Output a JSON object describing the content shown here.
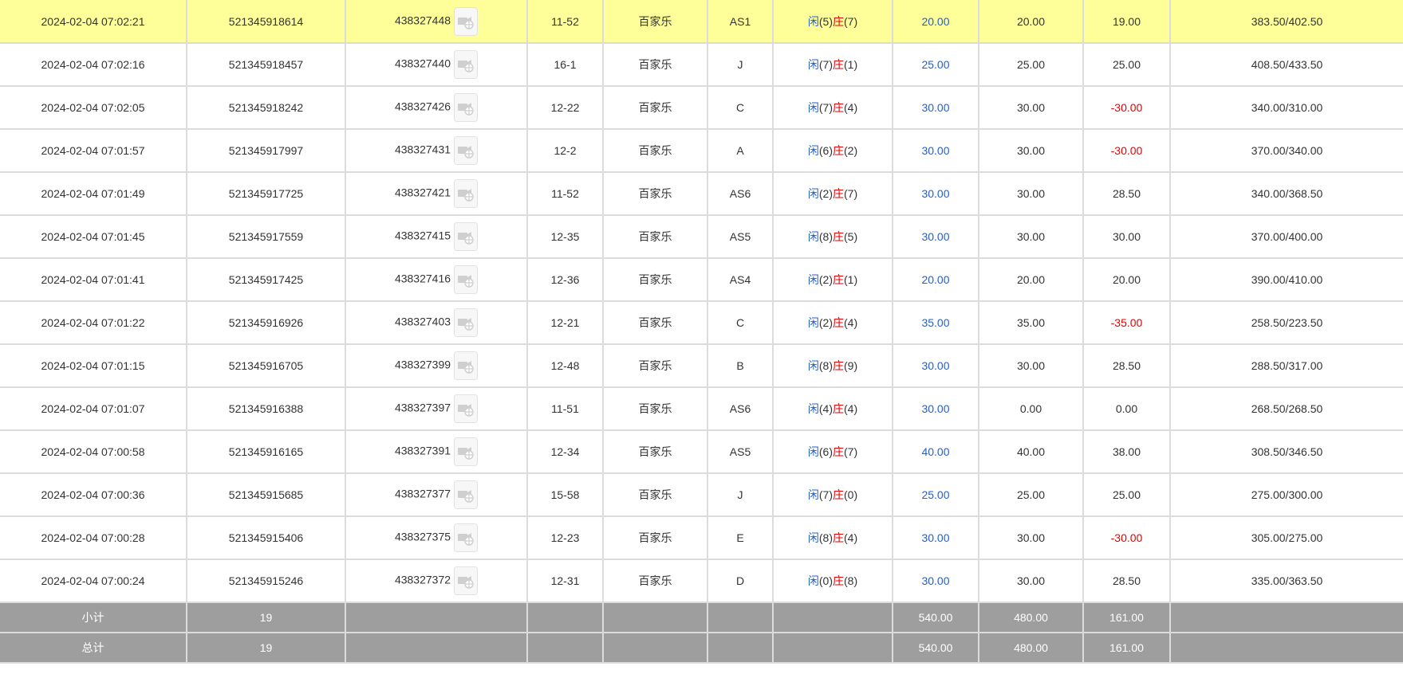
{
  "rows": [
    {
      "time": "2024-02-04 07:02:21",
      "order_no": "521345918614",
      "round_no": "438327448",
      "shoe": "11-52",
      "game": "百家乐",
      "table": "AS1",
      "player_label": "闲",
      "player_score": "(5)",
      "banker_label": "庄",
      "banker_score": "(7)",
      "bet": "20.00",
      "valid_bet": "20.00",
      "win_loss": "19.00",
      "win_loss_negative": false,
      "balance": "383.50/402.50",
      "highlight": true
    },
    {
      "time": "2024-02-04 07:02:16",
      "order_no": "521345918457",
      "round_no": "438327440",
      "shoe": "16-1",
      "game": "百家乐",
      "table": "J",
      "player_label": "闲",
      "player_score": "(7)",
      "banker_label": "庄",
      "banker_score": "(1)",
      "bet": "25.00",
      "valid_bet": "25.00",
      "win_loss": "25.00",
      "win_loss_negative": false,
      "balance": "408.50/433.50",
      "highlight": false
    },
    {
      "time": "2024-02-04 07:02:05",
      "order_no": "521345918242",
      "round_no": "438327426",
      "shoe": "12-22",
      "game": "百家乐",
      "table": "C",
      "player_label": "闲",
      "player_score": "(7)",
      "banker_label": "庄",
      "banker_score": "(4)",
      "bet": "30.00",
      "valid_bet": "30.00",
      "win_loss": "-30.00",
      "win_loss_negative": true,
      "balance": "340.00/310.00",
      "highlight": false
    },
    {
      "time": "2024-02-04 07:01:57",
      "order_no": "521345917997",
      "round_no": "438327431",
      "shoe": "12-2",
      "game": "百家乐",
      "table": "A",
      "player_label": "闲",
      "player_score": "(6)",
      "banker_label": "庄",
      "banker_score": "(2)",
      "bet": "30.00",
      "valid_bet": "30.00",
      "win_loss": "-30.00",
      "win_loss_negative": true,
      "balance": "370.00/340.00",
      "highlight": false
    },
    {
      "time": "2024-02-04 07:01:49",
      "order_no": "521345917725",
      "round_no": "438327421",
      "shoe": "11-52",
      "game": "百家乐",
      "table": "AS6",
      "player_label": "闲",
      "player_score": "(2)",
      "banker_label": "庄",
      "banker_score": "(7)",
      "bet": "30.00",
      "valid_bet": "30.00",
      "win_loss": "28.50",
      "win_loss_negative": false,
      "balance": "340.00/368.50",
      "highlight": false
    },
    {
      "time": "2024-02-04 07:01:45",
      "order_no": "521345917559",
      "round_no": "438327415",
      "shoe": "12-35",
      "game": "百家乐",
      "table": "AS5",
      "player_label": "闲",
      "player_score": "(8)",
      "banker_label": "庄",
      "banker_score": "(5)",
      "bet": "30.00",
      "valid_bet": "30.00",
      "win_loss": "30.00",
      "win_loss_negative": false,
      "balance": "370.00/400.00",
      "highlight": false
    },
    {
      "time": "2024-02-04 07:01:41",
      "order_no": "521345917425",
      "round_no": "438327416",
      "shoe": "12-36",
      "game": "百家乐",
      "table": "AS4",
      "player_label": "闲",
      "player_score": "(2)",
      "banker_label": "庄",
      "banker_score": "(1)",
      "bet": "20.00",
      "valid_bet": "20.00",
      "win_loss": "20.00",
      "win_loss_negative": false,
      "balance": "390.00/410.00",
      "highlight": false
    },
    {
      "time": "2024-02-04 07:01:22",
      "order_no": "521345916926",
      "round_no": "438327403",
      "shoe": "12-21",
      "game": "百家乐",
      "table": "C",
      "player_label": "闲",
      "player_score": "(2)",
      "banker_label": "庄",
      "banker_score": "(4)",
      "bet": "35.00",
      "valid_bet": "35.00",
      "win_loss": "-35.00",
      "win_loss_negative": true,
      "balance": "258.50/223.50",
      "highlight": false
    },
    {
      "time": "2024-02-04 07:01:15",
      "order_no": "521345916705",
      "round_no": "438327399",
      "shoe": "12-48",
      "game": "百家乐",
      "table": "B",
      "player_label": "闲",
      "player_score": "(8)",
      "banker_label": "庄",
      "banker_score": "(9)",
      "bet": "30.00",
      "valid_bet": "30.00",
      "win_loss": "28.50",
      "win_loss_negative": false,
      "balance": "288.50/317.00",
      "highlight": false
    },
    {
      "time": "2024-02-04 07:01:07",
      "order_no": "521345916388",
      "round_no": "438327397",
      "shoe": "11-51",
      "game": "百家乐",
      "table": "AS6",
      "player_label": "闲",
      "player_score": "(4)",
      "banker_label": "庄",
      "banker_score": "(4)",
      "bet": "30.00",
      "valid_bet": "0.00",
      "win_loss": "0.00",
      "win_loss_negative": false,
      "balance": "268.50/268.50",
      "highlight": false
    },
    {
      "time": "2024-02-04 07:00:58",
      "order_no": "521345916165",
      "round_no": "438327391",
      "shoe": "12-34",
      "game": "百家乐",
      "table": "AS5",
      "player_label": "闲",
      "player_score": "(6)",
      "banker_label": "庄",
      "banker_score": "(7)",
      "bet": "40.00",
      "valid_bet": "40.00",
      "win_loss": "38.00",
      "win_loss_negative": false,
      "balance": "308.50/346.50",
      "highlight": false
    },
    {
      "time": "2024-02-04 07:00:36",
      "order_no": "521345915685",
      "round_no": "438327377",
      "shoe": "15-58",
      "game": "百家乐",
      "table": "J",
      "player_label": "闲",
      "player_score": "(7)",
      "banker_label": "庄",
      "banker_score": "(0)",
      "bet": "25.00",
      "valid_bet": "25.00",
      "win_loss": "25.00",
      "win_loss_negative": false,
      "balance": "275.00/300.00",
      "highlight": false
    },
    {
      "time": "2024-02-04 07:00:28",
      "order_no": "521345915406",
      "round_no": "438327375",
      "shoe": "12-23",
      "game": "百家乐",
      "table": "E",
      "player_label": "闲",
      "player_score": "(8)",
      "banker_label": "庄",
      "banker_score": "(4)",
      "bet": "30.00",
      "valid_bet": "30.00",
      "win_loss": "-30.00",
      "win_loss_negative": true,
      "balance": "305.00/275.00",
      "highlight": false
    },
    {
      "time": "2024-02-04 07:00:24",
      "order_no": "521345915246",
      "round_no": "438327372",
      "shoe": "12-31",
      "game": "百家乐",
      "table": "D",
      "player_label": "闲",
      "player_score": "(0)",
      "banker_label": "庄",
      "banker_score": "(8)",
      "bet": "30.00",
      "valid_bet": "30.00",
      "win_loss": "28.50",
      "win_loss_negative": false,
      "balance": "335.00/363.50",
      "highlight": false
    }
  ],
  "summary": [
    {
      "label": "小计",
      "count": "19",
      "bet": "540.00",
      "valid_bet": "480.00",
      "win_loss": "161.00"
    },
    {
      "label": "总计",
      "count": "19",
      "bet": "540.00",
      "valid_bet": "480.00",
      "win_loss": "161.00"
    }
  ],
  "icons": {
    "video": "video-replay-icon"
  },
  "colors": {
    "highlight_row": "#ffff99",
    "player_blue": "#1f5fd6",
    "banker_red": "#e60000",
    "negative_red": "#e60000",
    "summary_bg": "#9e9e9e",
    "grid_line": "#dcdcdc"
  }
}
